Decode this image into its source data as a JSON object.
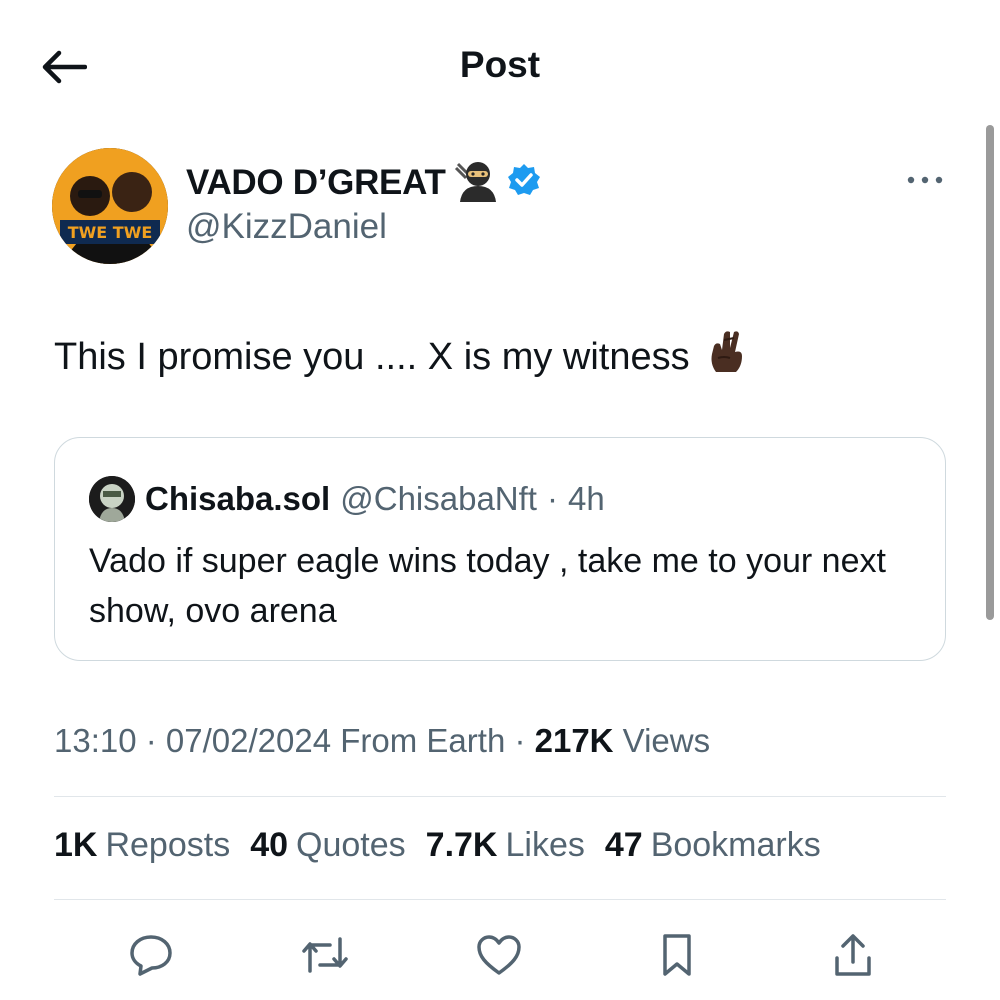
{
  "header": {
    "title": "Post"
  },
  "author": {
    "name": "VADO D’GREAT",
    "handle": "@KizzDaniel",
    "avatar_text": "TWE TWE"
  },
  "post": {
    "text": "This I promise you ....  X is my witness"
  },
  "quote": {
    "name": "Chisaba.sol",
    "handle": "@ChisabaNft",
    "dot": "·",
    "time": "4h",
    "text": "Vado if super eagle wins today , take me to your next show, ovo arena"
  },
  "meta": {
    "time": "13:10",
    "sep1": " · ",
    "date": "07/02/2024",
    "source": " From Earth",
    "sep2": " · ",
    "views_count": "217K",
    "views_label": " Views"
  },
  "stats": {
    "reposts_count": "1K",
    "reposts_label": "Reposts",
    "quotes_count": "40",
    "quotes_label": "Quotes",
    "likes_count": "7.7K",
    "likes_label": "Likes",
    "bookmarks_count": "47",
    "bookmarks_label": "Bookmarks"
  },
  "icons": {
    "back": "back-arrow-icon",
    "verified": "verified-badge-icon",
    "ninja_emoji": "ninja-emoji-icon",
    "crossed_fingers_emoji": "crossed-fingers-emoji-icon",
    "more": "more-dots-icon",
    "reply": "reply-icon",
    "repost": "repost-icon",
    "like": "like-icon",
    "bookmark": "bookmark-icon",
    "share": "share-icon"
  },
  "colors": {
    "text": "#0f1419",
    "secondary": "#536471",
    "verified": "#1d9bf0",
    "border": "#cfd9de",
    "avatar_orange": "#f0a020"
  }
}
